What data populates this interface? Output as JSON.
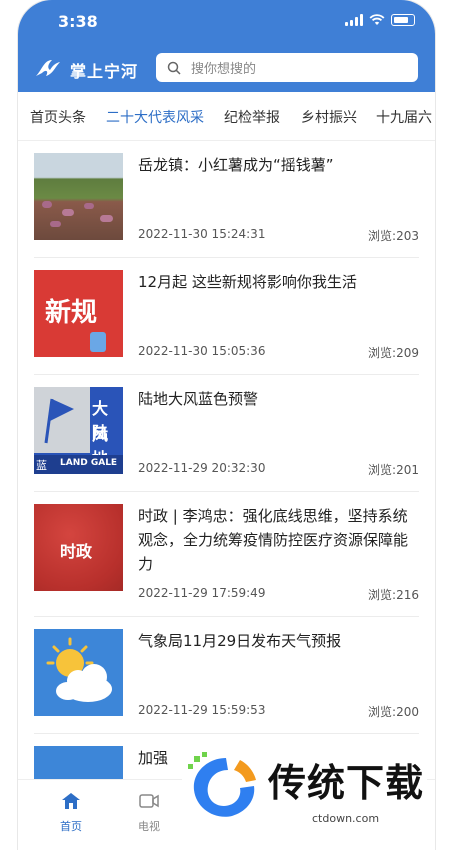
{
  "status_bar": {
    "time": "3:38"
  },
  "header": {
    "app_title": "掌上宁河",
    "search_placeholder": "搜你想搜的"
  },
  "tabs": [
    {
      "label": "首页头条"
    },
    {
      "label": "二十大代表风采",
      "active": true
    },
    {
      "label": "纪检举报"
    },
    {
      "label": "乡村振兴"
    },
    {
      "label": "十九届六"
    }
  ],
  "articles": [
    {
      "title": "岳龙镇：小红薯成为“摇钱薯”",
      "date": "2022-11-30 15:24:31",
      "views": "浏览:203",
      "thumb_text": ""
    },
    {
      "title": "12月起 这些新规将影响你我生活",
      "date": "2022-11-30 15:05:36",
      "views": "浏览:209",
      "thumb_text": "新规"
    },
    {
      "title": "陆地大风蓝色预警",
      "date": "2022-11-29 20:32:30",
      "views": "浏览:201",
      "thumb_text_1": "大陆",
      "thumb_text_2": "风地",
      "thumb_text_3": "蓝",
      "thumb_text_4": "LAND GALE"
    },
    {
      "title": "时政 | 李鸿忠：强化底线思维，坚持系统观念，全力统筹疫情防控医疗资源保障能力",
      "date": "2022-11-29 17:59:49",
      "views": "浏览:216",
      "thumb_text": "时政"
    },
    {
      "title": "气象局11月29日发布天气预报",
      "date": "2022-11-29 15:59:53",
      "views": "浏览:200",
      "thumb_text": ""
    },
    {
      "title": "加强",
      "date": "",
      "views": "",
      "thumb_text": ""
    }
  ],
  "tabbar": [
    {
      "label": "首页",
      "icon": "home-icon",
      "active": true
    },
    {
      "label": "电视",
      "icon": "video-icon"
    }
  ],
  "watermark": {
    "text": "传统下载",
    "url": "ctdown.com"
  },
  "colors": {
    "brand_blue": "#3f7fd6",
    "active_tab": "#2d6ec6"
  }
}
